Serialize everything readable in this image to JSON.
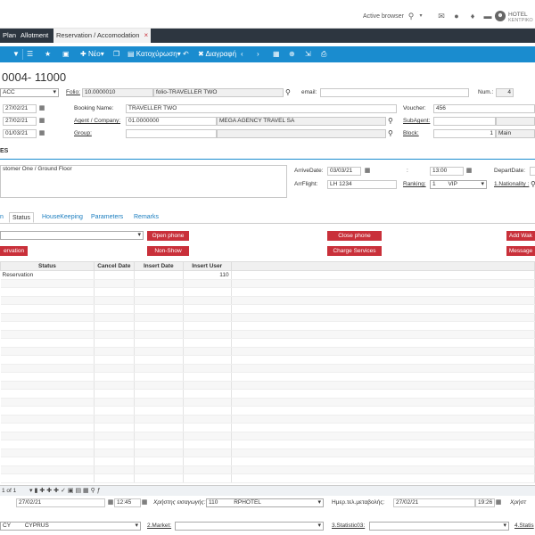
{
  "topbar": {
    "browser_status": "Active browser",
    "user_line1": "HOTEL",
    "user_line2": "ΚΕΝΤΡΙΚΟ"
  },
  "tabs": [
    {
      "label": "Plan"
    },
    {
      "label": "Allotment"
    },
    {
      "label": "Reservation / Accomodation",
      "close": "×"
    }
  ],
  "toolbar": {
    "new_label": "Νέο",
    "status_label": "Κατοχύρωση",
    "delete_label": "Διαγραφή"
  },
  "page_title": "0004- 11000",
  "form": {
    "acc_value": "ACC",
    "folio_label": "Folio:",
    "folio_number": "10.0000010",
    "folio_name": "folio-TRAVELLER TWO",
    "email_label": "email:",
    "email_value": "",
    "num_label": "Num.:",
    "num_value": "4",
    "date1": "27/02/21",
    "booking_name_label": "Booking Name:",
    "booking_name_value": "TRAVELLER TWO",
    "voucher_label": "Voucher:",
    "voucher_value": "456",
    "date2": "27/02/21",
    "agent_label": "Agent / Company:",
    "agent_code": "01.0000000",
    "agent_name": "MEGA AGENCY TRAVEL SA",
    "subagent_label": "SubAgent:",
    "date3": "01/03/21",
    "group_label": "Group:",
    "block_label": "Block:",
    "block_num": "1",
    "block_name": "Main"
  },
  "section": {
    "header": "ES",
    "notes_text": "stomer One / Ground Floor",
    "arrive_label": "ArriveDate:",
    "arrive_date": "03/03/21",
    "colon": ":",
    "arrive_time": "13:00",
    "depart_label": "DepartDate:",
    "arrflight_label": "ArrFlight:",
    "arrflight_value": "LH 1234",
    "ranking_label": "Ranking:",
    "ranking_num": "1",
    "ranking_value": "VIP",
    "nationality_label": "1.Nationality :"
  },
  "subtabs": [
    {
      "label": "n"
    },
    {
      "label": "Status"
    },
    {
      "label": "HouseKeeping"
    },
    {
      "label": "Parameters"
    },
    {
      "label": "Remarks"
    }
  ],
  "buttons": {
    "open_phone": "Open phone",
    "close_phone": "Close phone",
    "add_wake": "Add Wak",
    "reservation": "ervation",
    "non_show": "Non-Show",
    "charge_services": "Charge Services",
    "message": "Message"
  },
  "grid": {
    "columns": [
      "Status",
      "Cancel Date",
      "Insert Date",
      "Insert User"
    ],
    "rows": [
      {
        "status": "Reservation",
        "cancel": "",
        "insert_date": "",
        "user": "110"
      }
    ]
  },
  "pager": {
    "page_text": "1 of 1"
  },
  "bottom": {
    "date_a": "27/02/21",
    "time_a": "12:45",
    "user_sign_label": "Χρήστης εισαγωγής:",
    "user_sign_code": "110",
    "user_sign_name": "RPHOTEL",
    "lastmod_label": "Ημερ.τελ.μεταβολής:",
    "lastmod_date": "27/02/21",
    "lastmod_time": "19:26",
    "user_short": "Χρήστ",
    "country_code": "CY",
    "country_name": "CYPRUS",
    "market_label": "2.Market:",
    "stat3_label": "3.Statistic03:",
    "stat4_label": "4.Statis"
  },
  "colors": {
    "toolbar": "#1a8ccf",
    "tabbar": "#2d3640",
    "button": "#c9303a"
  }
}
